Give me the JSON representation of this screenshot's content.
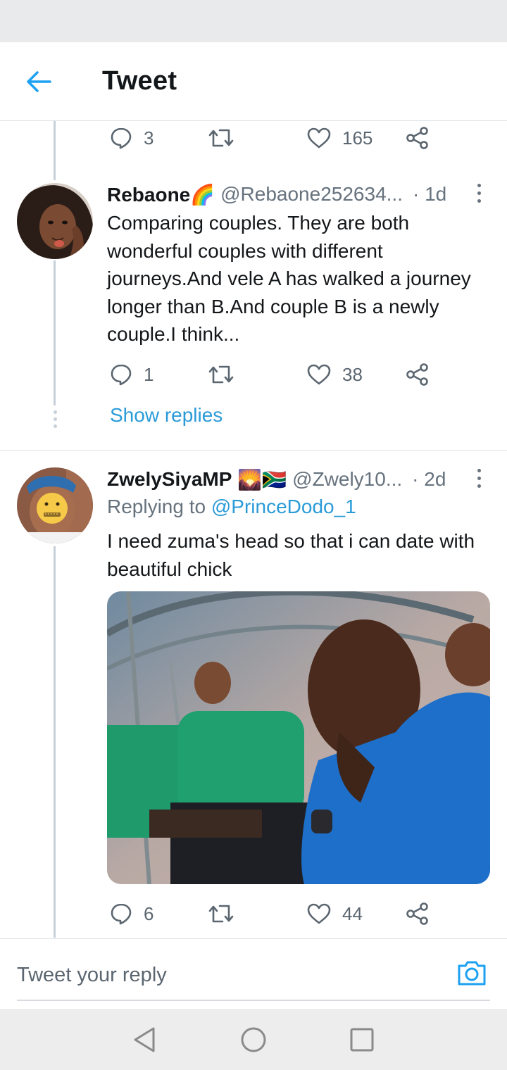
{
  "header": {
    "title": "Tweet"
  },
  "colors": {
    "accent": "#1da1f2",
    "link": "#2b9bd8",
    "muted": "#66727d",
    "thread_line": "#c7d0d8"
  },
  "top_tweet": {
    "stats": {
      "replies": "3",
      "likes": "165"
    }
  },
  "tweets": [
    {
      "name": "Rebaone🌈",
      "handle": "@Rebaone252634...",
      "time": "· 1d",
      "text": "Comparing couples. They are both wonderful couples with different journeys.And vele A has walked a journey longer than B.And couple B is a newly couple.I think...",
      "stats": {
        "replies": "1",
        "likes": "38"
      },
      "show_replies": "Show replies"
    },
    {
      "name": "ZwelySiyaMP",
      "name_emoji": "🌄🇿🇦",
      "handle": "@Zwely10...",
      "time": "· 2d",
      "replying_prefix": "Replying to",
      "replying_to": "@PrinceDodo_1",
      "text": "I need zuma's head so that i can date with beautiful chick",
      "stats": {
        "replies": "6",
        "likes": "44"
      }
    }
  ],
  "composer": {
    "placeholder": "Tweet your reply"
  },
  "icons": [
    "back-arrow-icon",
    "reply-icon",
    "retweet-icon",
    "like-icon",
    "share-icon",
    "more-icon",
    "camera-icon",
    "nav-back-icon",
    "nav-home-icon",
    "nav-recents-icon"
  ]
}
